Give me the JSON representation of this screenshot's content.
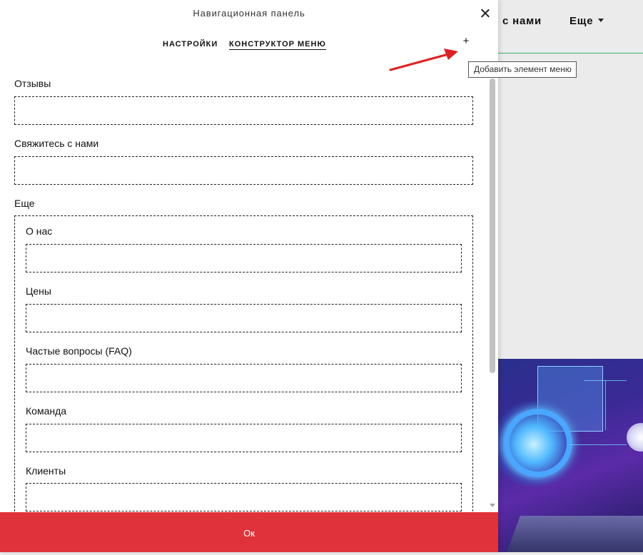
{
  "background_site": {
    "nav_items": [
      "с нами",
      "Еще"
    ]
  },
  "modal": {
    "title": "Навигационная панель",
    "tabs": [
      {
        "label": "НАСТРОЙКИ",
        "active": false
      },
      {
        "label": "КОНСТРУКТОР МЕНЮ",
        "active": true
      }
    ],
    "add_button_label": "+",
    "add_tooltip": "Добавить элемент меню",
    "menu_items": [
      {
        "label": "Отзывы"
      },
      {
        "label": "Свяжитесь с нами"
      },
      {
        "label": "Еще",
        "children": [
          {
            "label": "О нас"
          },
          {
            "label": "Цены"
          },
          {
            "label": "Частые вопросы (FAQ)"
          },
          {
            "label": "Команда"
          },
          {
            "label": "Клиенты"
          }
        ]
      }
    ],
    "ok_label": "Ок"
  },
  "colors": {
    "accent_red": "#e0323a",
    "nav_border_green": "#3cae6b",
    "annotation_arrow": "#e02020"
  }
}
